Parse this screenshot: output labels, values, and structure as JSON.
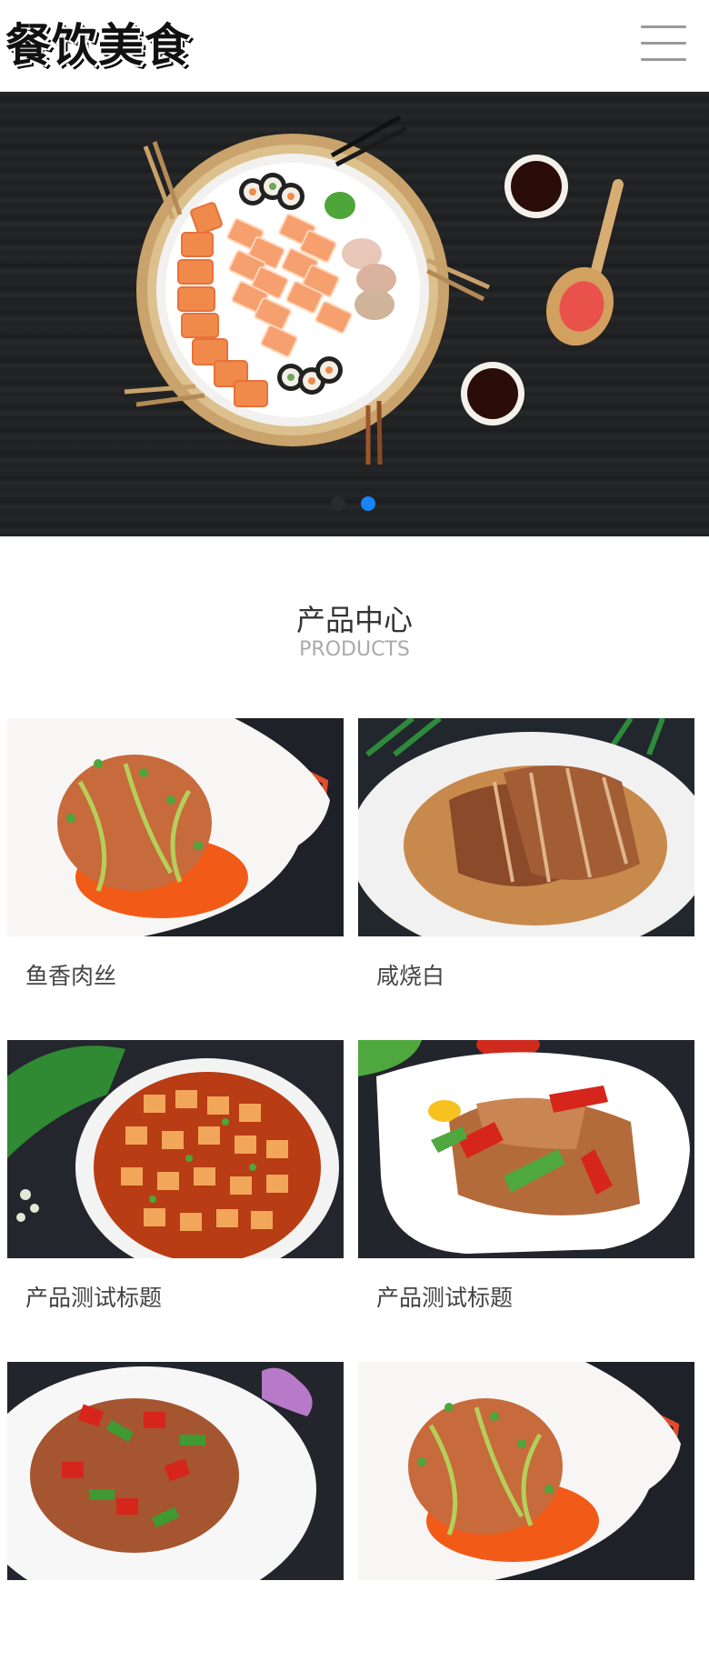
{
  "header": {
    "logo_text": "餐饮美食",
    "menu_icon": "hamburger-menu-icon"
  },
  "banner": {
    "slide_count": 2,
    "active_slide": 2
  },
  "section": {
    "title": "产品中心",
    "subtitle": "PRODUCTS"
  },
  "products": [
    {
      "name": "鱼香肉丝"
    },
    {
      "name": "咸烧白"
    },
    {
      "name": "产品测试标题"
    },
    {
      "name": "产品测试标题"
    },
    {
      "name": ""
    },
    {
      "name": ""
    }
  ],
  "colors": {
    "accent": "#1685f8",
    "banner_bg": "#232426",
    "text": "#333333"
  }
}
